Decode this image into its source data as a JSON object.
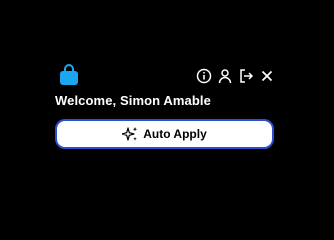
{
  "header": {
    "logo_icon": "shopping-bag-icon",
    "logo_color": "#1aa7f0",
    "icons": [
      "info-icon",
      "user-icon",
      "logout-icon",
      "close-icon"
    ]
  },
  "welcome": {
    "text": "Welcome, Simon Amable"
  },
  "auto_apply": {
    "label": "Auto Apply",
    "icon": "sparkle-icon",
    "border_color": "#2b4fd0"
  }
}
